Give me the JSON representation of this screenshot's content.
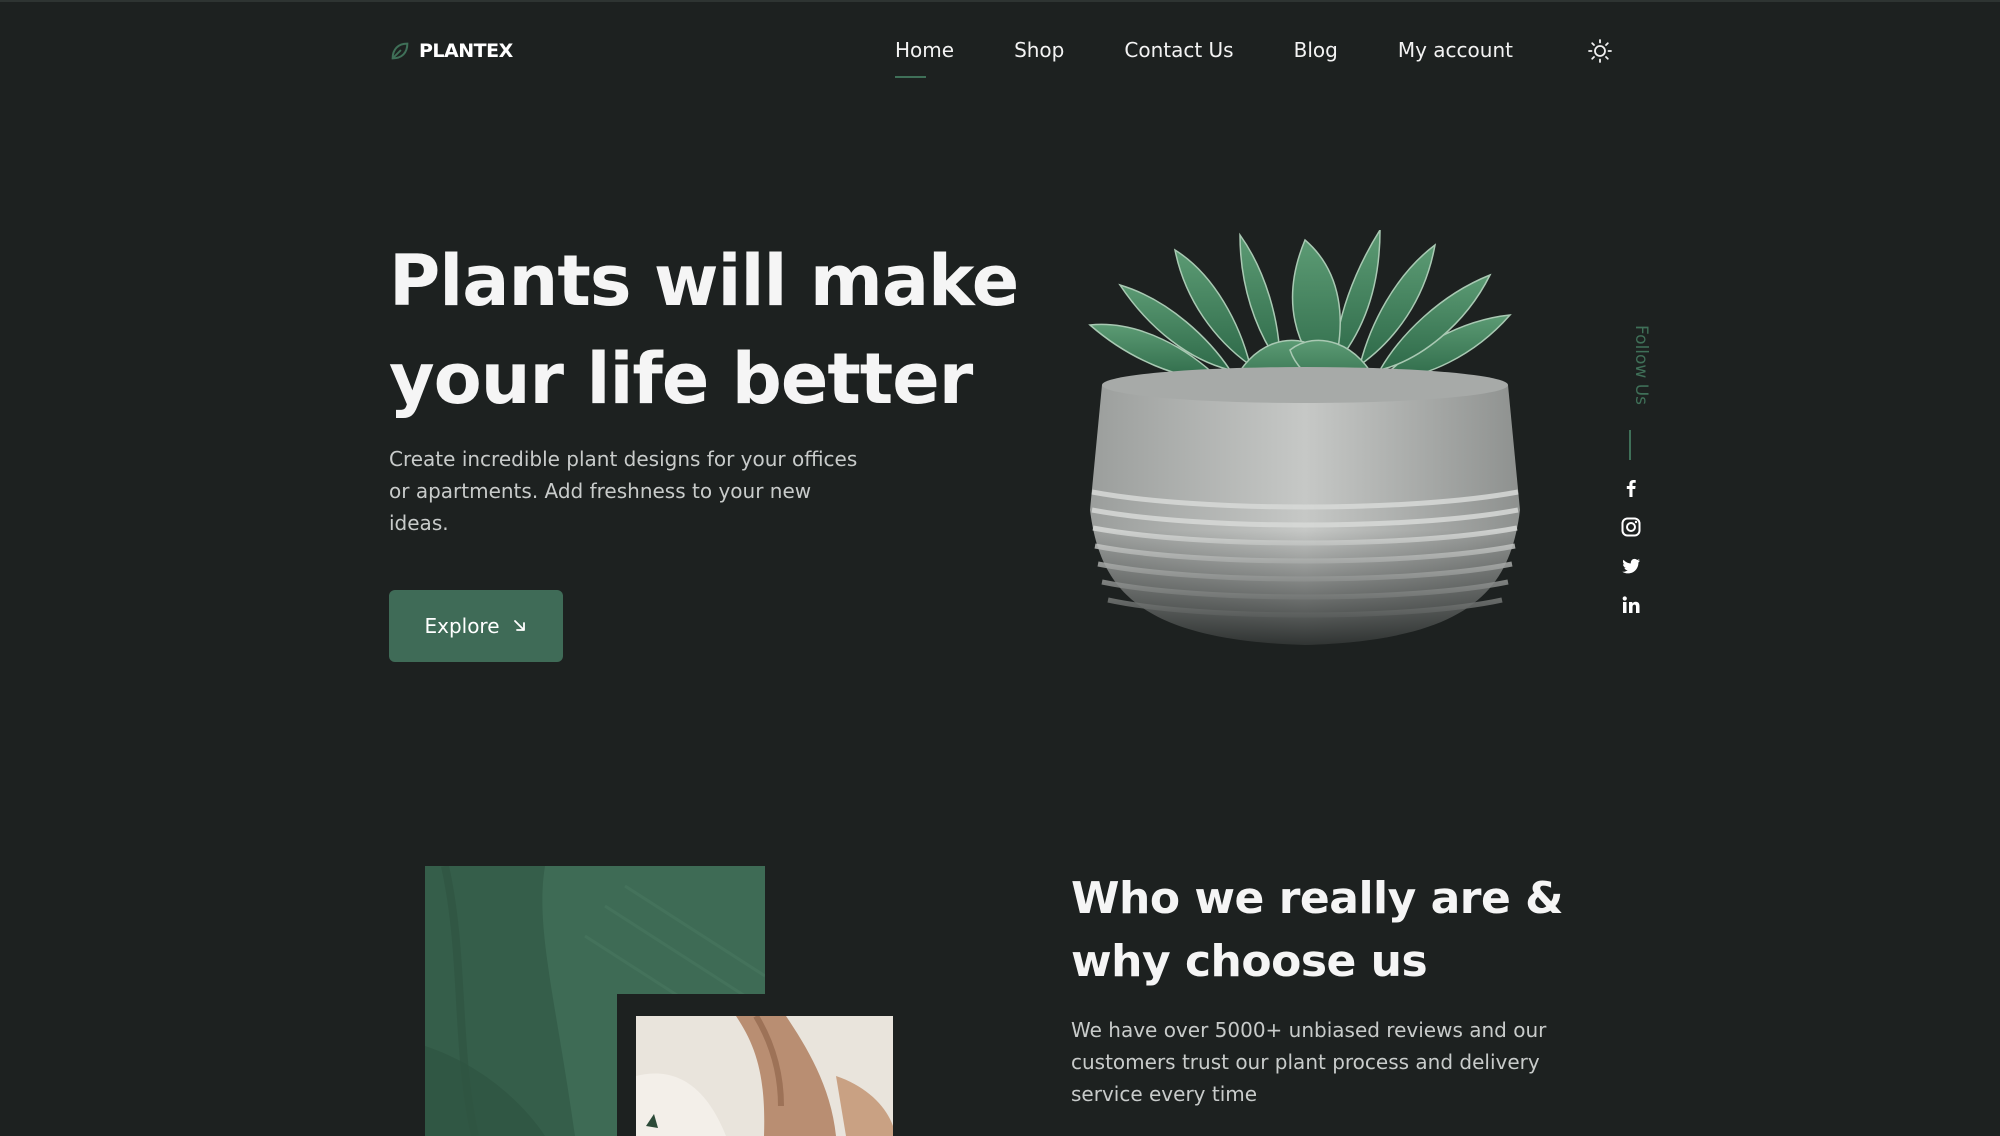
{
  "brand": {
    "name": "PLANTEX",
    "logo_icon": "leaf-icon"
  },
  "nav": {
    "items": [
      {
        "label": "Home",
        "active": true
      },
      {
        "label": "Shop",
        "active": false
      },
      {
        "label": "Contact Us",
        "active": false
      },
      {
        "label": "Blog",
        "active": false
      },
      {
        "label": "My account",
        "active": false
      }
    ],
    "theme_toggle_icon": "sun-icon"
  },
  "hero": {
    "title": "Plants will make your life better",
    "description": "Create incredible plant designs for your offices or apartments. Add freshness to your new ideas.",
    "button_label": "Explore",
    "button_icon": "arrow-down-right-icon",
    "image_icon": "succulent-pot-image"
  },
  "social": {
    "label": "Follow Us",
    "icons": [
      "facebook-icon",
      "instagram-icon",
      "twitter-icon",
      "linkedin-icon"
    ]
  },
  "about": {
    "title": "Who we really are & why choose us",
    "description": "We have over 5000+ unbiased reviews and our customers trust our plant process and delivery service every time"
  },
  "colors": {
    "background": "#1d2120",
    "accent": "#3f6b57",
    "text": "#f5f5f5",
    "muted_text": "#c8cbca"
  }
}
